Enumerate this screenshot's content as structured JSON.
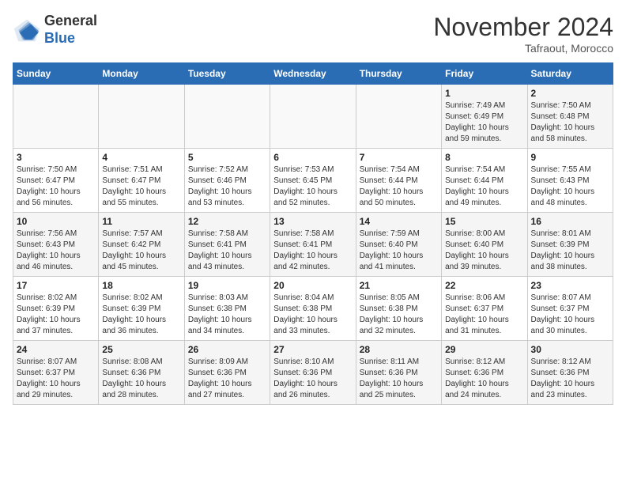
{
  "header": {
    "logo_general": "General",
    "logo_blue": "Blue",
    "month_title": "November 2024",
    "subtitle": "Tafraout, Morocco"
  },
  "days_of_week": [
    "Sunday",
    "Monday",
    "Tuesday",
    "Wednesday",
    "Thursday",
    "Friday",
    "Saturday"
  ],
  "weeks": [
    [
      {
        "day": "",
        "info": ""
      },
      {
        "day": "",
        "info": ""
      },
      {
        "day": "",
        "info": ""
      },
      {
        "day": "",
        "info": ""
      },
      {
        "day": "",
        "info": ""
      },
      {
        "day": "1",
        "info": "Sunrise: 7:49 AM\nSunset: 6:49 PM\nDaylight: 10 hours and 59 minutes."
      },
      {
        "day": "2",
        "info": "Sunrise: 7:50 AM\nSunset: 6:48 PM\nDaylight: 10 hours and 58 minutes."
      }
    ],
    [
      {
        "day": "3",
        "info": "Sunrise: 7:50 AM\nSunset: 6:47 PM\nDaylight: 10 hours and 56 minutes."
      },
      {
        "day": "4",
        "info": "Sunrise: 7:51 AM\nSunset: 6:47 PM\nDaylight: 10 hours and 55 minutes."
      },
      {
        "day": "5",
        "info": "Sunrise: 7:52 AM\nSunset: 6:46 PM\nDaylight: 10 hours and 53 minutes."
      },
      {
        "day": "6",
        "info": "Sunrise: 7:53 AM\nSunset: 6:45 PM\nDaylight: 10 hours and 52 minutes."
      },
      {
        "day": "7",
        "info": "Sunrise: 7:54 AM\nSunset: 6:44 PM\nDaylight: 10 hours and 50 minutes."
      },
      {
        "day": "8",
        "info": "Sunrise: 7:54 AM\nSunset: 6:44 PM\nDaylight: 10 hours and 49 minutes."
      },
      {
        "day": "9",
        "info": "Sunrise: 7:55 AM\nSunset: 6:43 PM\nDaylight: 10 hours and 48 minutes."
      }
    ],
    [
      {
        "day": "10",
        "info": "Sunrise: 7:56 AM\nSunset: 6:43 PM\nDaylight: 10 hours and 46 minutes."
      },
      {
        "day": "11",
        "info": "Sunrise: 7:57 AM\nSunset: 6:42 PM\nDaylight: 10 hours and 45 minutes."
      },
      {
        "day": "12",
        "info": "Sunrise: 7:58 AM\nSunset: 6:41 PM\nDaylight: 10 hours and 43 minutes."
      },
      {
        "day": "13",
        "info": "Sunrise: 7:58 AM\nSunset: 6:41 PM\nDaylight: 10 hours and 42 minutes."
      },
      {
        "day": "14",
        "info": "Sunrise: 7:59 AM\nSunset: 6:40 PM\nDaylight: 10 hours and 41 minutes."
      },
      {
        "day": "15",
        "info": "Sunrise: 8:00 AM\nSunset: 6:40 PM\nDaylight: 10 hours and 39 minutes."
      },
      {
        "day": "16",
        "info": "Sunrise: 8:01 AM\nSunset: 6:39 PM\nDaylight: 10 hours and 38 minutes."
      }
    ],
    [
      {
        "day": "17",
        "info": "Sunrise: 8:02 AM\nSunset: 6:39 PM\nDaylight: 10 hours and 37 minutes."
      },
      {
        "day": "18",
        "info": "Sunrise: 8:02 AM\nSunset: 6:39 PM\nDaylight: 10 hours and 36 minutes."
      },
      {
        "day": "19",
        "info": "Sunrise: 8:03 AM\nSunset: 6:38 PM\nDaylight: 10 hours and 34 minutes."
      },
      {
        "day": "20",
        "info": "Sunrise: 8:04 AM\nSunset: 6:38 PM\nDaylight: 10 hours and 33 minutes."
      },
      {
        "day": "21",
        "info": "Sunrise: 8:05 AM\nSunset: 6:38 PM\nDaylight: 10 hours and 32 minutes."
      },
      {
        "day": "22",
        "info": "Sunrise: 8:06 AM\nSunset: 6:37 PM\nDaylight: 10 hours and 31 minutes."
      },
      {
        "day": "23",
        "info": "Sunrise: 8:07 AM\nSunset: 6:37 PM\nDaylight: 10 hours and 30 minutes."
      }
    ],
    [
      {
        "day": "24",
        "info": "Sunrise: 8:07 AM\nSunset: 6:37 PM\nDaylight: 10 hours and 29 minutes."
      },
      {
        "day": "25",
        "info": "Sunrise: 8:08 AM\nSunset: 6:36 PM\nDaylight: 10 hours and 28 minutes."
      },
      {
        "day": "26",
        "info": "Sunrise: 8:09 AM\nSunset: 6:36 PM\nDaylight: 10 hours and 27 minutes."
      },
      {
        "day": "27",
        "info": "Sunrise: 8:10 AM\nSunset: 6:36 PM\nDaylight: 10 hours and 26 minutes."
      },
      {
        "day": "28",
        "info": "Sunrise: 8:11 AM\nSunset: 6:36 PM\nDaylight: 10 hours and 25 minutes."
      },
      {
        "day": "29",
        "info": "Sunrise: 8:12 AM\nSunset: 6:36 PM\nDaylight: 10 hours and 24 minutes."
      },
      {
        "day": "30",
        "info": "Sunrise: 8:12 AM\nSunset: 6:36 PM\nDaylight: 10 hours and 23 minutes."
      }
    ]
  ]
}
